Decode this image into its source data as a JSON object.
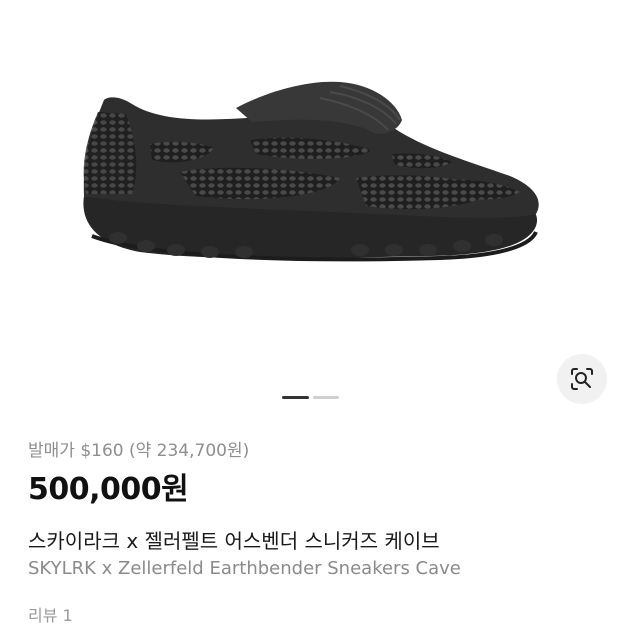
{
  "product": {
    "release_price": "발매가 $160 (약 234,700원)",
    "price": "500,000원",
    "title_ko": "스카이라크 x 젤러펠트 어스벤더 스니커즈 케이브",
    "title_en": "SKYLRK x Zellerfeld Earthbender Sneakers Cave",
    "reviews": "리뷰 1"
  },
  "gallery": {
    "image_icon": "black-sneaker",
    "lens_icon": "visual-search-icon",
    "current_index": 1,
    "total_images": 2
  },
  "colors": {
    "text_primary": "#111111",
    "text_secondary": "#8e8e8e",
    "indicator_active": "#333333",
    "indicator_inactive": "#cfcfcf",
    "lens_bg": "#f1f1f1"
  }
}
